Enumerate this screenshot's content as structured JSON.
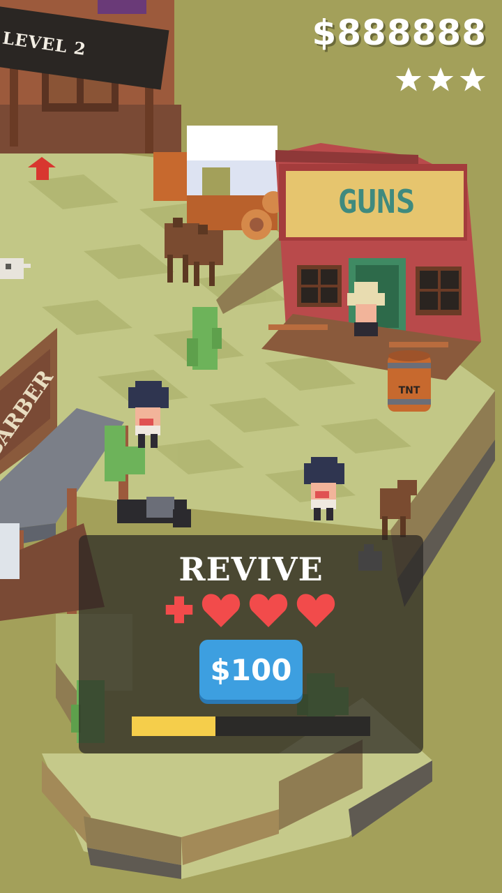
{
  "hud": {
    "money": "$888888",
    "stars_total": 3,
    "stars_earned": 3,
    "level_label": "LEVEL 2"
  },
  "signs": {
    "guns": "GUNS",
    "barber": "BARBER",
    "tnt": "TNT"
  },
  "revive": {
    "title": "REVIVE",
    "hearts": 3,
    "price_label": "$100",
    "timer_progress": 0.35
  },
  "colors": {
    "ground": "#a3a05a",
    "tile_light": "#c5c98a",
    "tile_dark": "#b3b874",
    "heart": "#f24b4b",
    "button": "#3d9fe0",
    "progress": "#f5ce4b"
  }
}
